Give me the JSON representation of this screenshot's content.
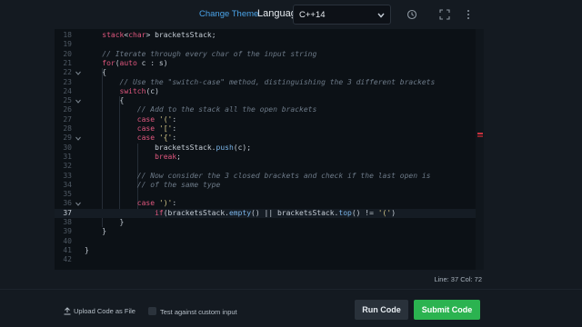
{
  "toolbar": {
    "change_theme": "Change Theme",
    "language_label": "Language",
    "language_value": "C++14",
    "icons": [
      "history-icon",
      "fullscreen-icon",
      "more-vertical-icon"
    ]
  },
  "editor": {
    "lines": [
      {
        "n": "18",
        "fold": false,
        "html": "    <span class=\"ty\">stack</span>&lt;<span class=\"ty\">char</span>&gt; bracketsStack;"
      },
      {
        "n": "19",
        "fold": false,
        "html": ""
      },
      {
        "n": "20",
        "fold": false,
        "html": "    <span class=\"cm\">// Iterate through every char of the input string</span>"
      },
      {
        "n": "21",
        "fold": false,
        "html": "    <span class=\"kw\">for</span>(<span class=\"kw\">auto</span> c : s)"
      },
      {
        "n": "22",
        "fold": true,
        "html": "    {"
      },
      {
        "n": "23",
        "fold": false,
        "html": "        <span class=\"cm\">// Use the \"switch-case\" method, distinguishing the 3 different brackets</span>"
      },
      {
        "n": "24",
        "fold": false,
        "html": "        <span class=\"kw\">switch</span>(c)"
      },
      {
        "n": "25",
        "fold": true,
        "html": "        {"
      },
      {
        "n": "26",
        "fold": false,
        "html": "            <span class=\"cm\">// Add to the stack all the open brackets</span>"
      },
      {
        "n": "27",
        "fold": false,
        "html": "            <span class=\"kw\">case</span> <span class=\"st\">'('</span>:"
      },
      {
        "n": "28",
        "fold": false,
        "html": "            <span class=\"kw\">case</span> <span class=\"st\">'['</span>:"
      },
      {
        "n": "29",
        "fold": true,
        "html": "            <span class=\"kw\">case</span> <span class=\"st\">'{'</span>:"
      },
      {
        "n": "30",
        "fold": false,
        "html": "                bracketsStack.<span class=\"fn\">push</span>(c);"
      },
      {
        "n": "31",
        "fold": false,
        "html": "                <span class=\"kw\">break</span>;"
      },
      {
        "n": "32",
        "fold": false,
        "html": ""
      },
      {
        "n": "33",
        "fold": false,
        "html": "            <span class=\"cm\">// Now consider the 3 closed brackets and check if the last open is</span>"
      },
      {
        "n": "34",
        "fold": false,
        "html": "            <span class=\"cm\">// of the same type</span>"
      },
      {
        "n": "35",
        "fold": false,
        "html": ""
      },
      {
        "n": "36",
        "fold": true,
        "html": "            <span class=\"kw\">case</span> <span class=\"st\">')'</span>:"
      },
      {
        "n": "37",
        "fold": false,
        "html": "                <span class=\"kw\">if</span>(bracketsStack.<span class=\"fn\">empty</span>() || bracketsStack.<span class=\"fn\">top</span>() != <span class=\"st\">'('</span>)",
        "active": true
      },
      {
        "n": "38",
        "fold": false,
        "html": "        }"
      },
      {
        "n": "39",
        "fold": false,
        "html": "    }"
      },
      {
        "n": "40",
        "fold": false,
        "html": ""
      },
      {
        "n": "41",
        "fold": false,
        "html": "}"
      },
      {
        "n": "42",
        "fold": false,
        "html": ""
      }
    ]
  },
  "status": {
    "cursor": "Line: 37 Col: 72"
  },
  "footer": {
    "upload_label": "Upload Code as File",
    "custom_input_label": "Test against custom input",
    "run_label": "Run Code",
    "submit_label": "Submit Code"
  },
  "colors": {
    "accent": "#4aa3e8",
    "submit": "#2bb350",
    "keyword": "#e0577e",
    "comment": "#6d7a88"
  }
}
